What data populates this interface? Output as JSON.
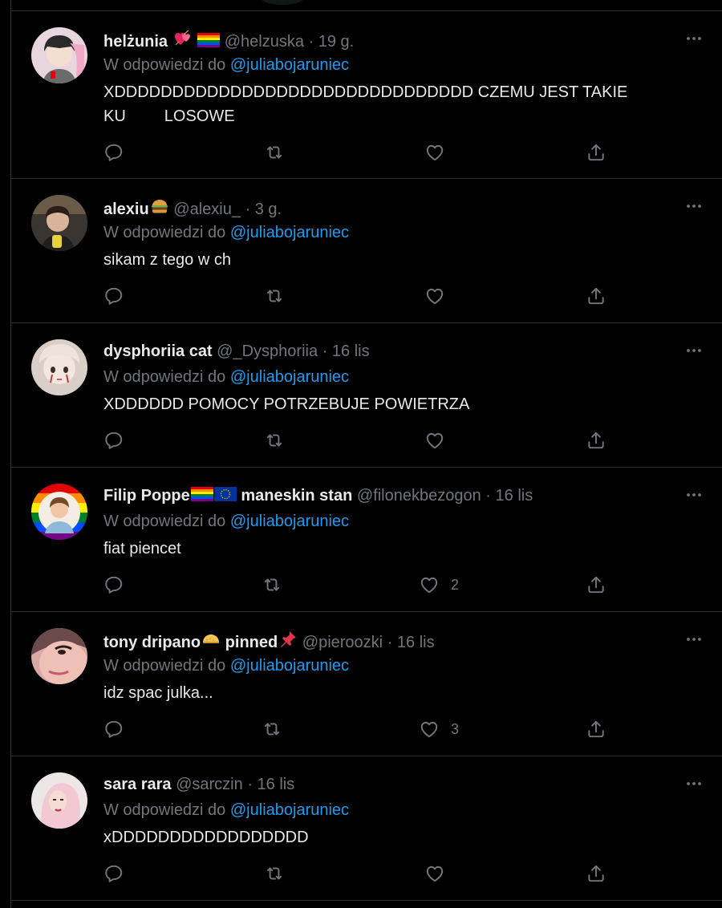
{
  "reply_prefix": "W odpowiedzi do",
  "tweets": [
    {
      "name": "helżunia",
      "emojis": [
        "heart-ribbon",
        "rainbow-flag"
      ],
      "handle": "@helzuska",
      "time": "19 g.",
      "reply_to": "@juliabojaruniec",
      "text_lines": [
        "XDDDDDDDDDDDDDDDDDDDDDDDDDDDDDDD CZEMU JEST TAKIE"
      ],
      "text_second_a": "KU",
      "text_second_b": "LOSOWE",
      "likes": ""
    },
    {
      "name": "alexiu",
      "emojis": [
        "burger"
      ],
      "handle": "@alexiu_",
      "time": "3 g.",
      "reply_to": "@juliabojaruniec",
      "text": "sikam z tego w ch",
      "likes": ""
    },
    {
      "name": "dysphoriia cat",
      "emojis": [],
      "handle": "@_Dysphoriia",
      "time": "16 lis",
      "reply_to": "@juliabojaruniec",
      "text": "XDDDDDD POMOCY POTRZEBUJE POWIETRZA",
      "likes": ""
    },
    {
      "name": "Filip Poppe",
      "name_suffix": "maneskin stan",
      "emojis": [
        "rainbow-flag",
        "eu-flag"
      ],
      "handle": "@filonekbezogon",
      "time": "16 lis",
      "reply_to": "@juliabojaruniec",
      "text": "fiat piencet",
      "likes": "2"
    },
    {
      "name": "tony dripano",
      "name_suffix": "pinned",
      "emojis": [
        "pie",
        "pushpin"
      ],
      "handle": "@pieroozki",
      "time": "16 lis",
      "reply_to": "@juliabojaruniec",
      "text": "idz spac julka...",
      "likes": "3"
    },
    {
      "name": "sara rara",
      "emojis": [],
      "handle": "@sarczin",
      "time": "16 lis",
      "reply_to": "@juliabojaruniec",
      "text": "xDDDDDDDDDDDDDDDDD",
      "likes": ""
    }
  ],
  "colors": {
    "background": "#000000",
    "text": "#e7e9ea",
    "muted": "#71767b",
    "link": "#1d9bf0",
    "border": "#2f3336"
  },
  "icons": [
    "reply-icon",
    "retweet-icon",
    "like-icon",
    "share-icon",
    "more-icon"
  ]
}
